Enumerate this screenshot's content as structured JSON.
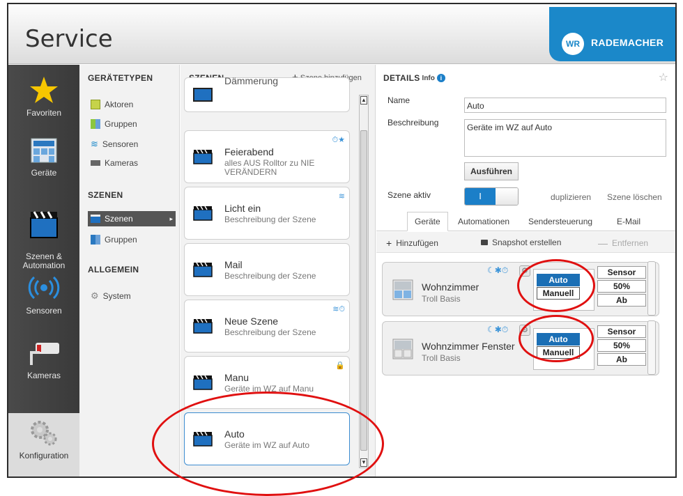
{
  "header": {
    "title": "Service",
    "brand_mark": "WR",
    "brand_name": "RADEMACHER"
  },
  "nav": {
    "items": [
      {
        "label": "Favoriten",
        "icon": "star-icon"
      },
      {
        "label": "Geräte",
        "icon": "house-icon"
      },
      {
        "label": "Szenen &\nAutomation",
        "icon": "clapperboard-icon"
      },
      {
        "label": "Sensoren",
        "icon": "sensor-icon"
      },
      {
        "label": "Kameras",
        "icon": "camera-icon"
      }
    ],
    "config": {
      "label": "Konfiguration",
      "icon": "gears-icon"
    }
  },
  "types": {
    "heading_types": "GERÄTETYPEN",
    "types": [
      {
        "label": "Aktoren",
        "color": "#8cc63f"
      },
      {
        "label": "Gruppen",
        "color": "#7ab648"
      },
      {
        "label": "Sensoren",
        "color": "#1b88c9"
      },
      {
        "label": "Kameras",
        "color": "#555555"
      }
    ],
    "heading_scenes": "SZENEN",
    "scenes_items": [
      {
        "label": "Szenen"
      },
      {
        "label": "Gruppen"
      }
    ],
    "heading_general": "ALLGEMEIN",
    "general_items": [
      {
        "label": "System"
      }
    ]
  },
  "scenes": {
    "heading": "SZENEN",
    "add_label": "Szene hinzufügen",
    "cards": [
      {
        "name": "Dämmerung",
        "desc": "",
        "badges": ""
      },
      {
        "name": "Feierabend",
        "desc": "alles AUS Rolltor zu NIE VERÄNDERN",
        "badges": "⏱★"
      },
      {
        "name": "Licht ein",
        "desc": "Beschreibung der Szene",
        "badges": "≋"
      },
      {
        "name": "Mail",
        "desc": "Beschreibung der Szene",
        "badges": ""
      },
      {
        "name": "Neue Szene",
        "desc": "Beschreibung der Szene",
        "badges": "≋⏱"
      },
      {
        "name": "Manu",
        "desc": "Geräte im WZ auf Manu",
        "badges": "🔒"
      },
      {
        "name": "Auto",
        "desc": "Geräte im WZ auf Auto",
        "badges": ""
      }
    ]
  },
  "details": {
    "heading": "DETAILS",
    "info_label": "Info",
    "name_label": "Name",
    "name_value": "Auto",
    "desc_label": "Beschreibung",
    "desc_value": "Geräte im WZ auf Auto",
    "run_button": "Ausführen",
    "active_label": "Szene aktiv",
    "toggle_on": "I",
    "duplicate": "duplizieren",
    "delete": "Szene löschen",
    "tabs": [
      "Geräte",
      "Automationen",
      "Sendersteuerung",
      "E-Mail"
    ],
    "toolbar": {
      "add": "Hinzufügen",
      "snapshot": "Snapshot erstellen",
      "remove": "Entfernen"
    },
    "devices": [
      {
        "name": "Wohnzimmer",
        "type": "Troll Basis",
        "auto": "Auto",
        "manual": "Manuell",
        "stack": [
          "Sensor",
          "50%",
          "Ab"
        ]
      },
      {
        "name": "Wohnzimmer Fenster",
        "type": "Troll Basis",
        "auto": "Auto",
        "manual": "Manuell",
        "stack": [
          "Sensor",
          "50%",
          "Ab"
        ]
      }
    ]
  }
}
